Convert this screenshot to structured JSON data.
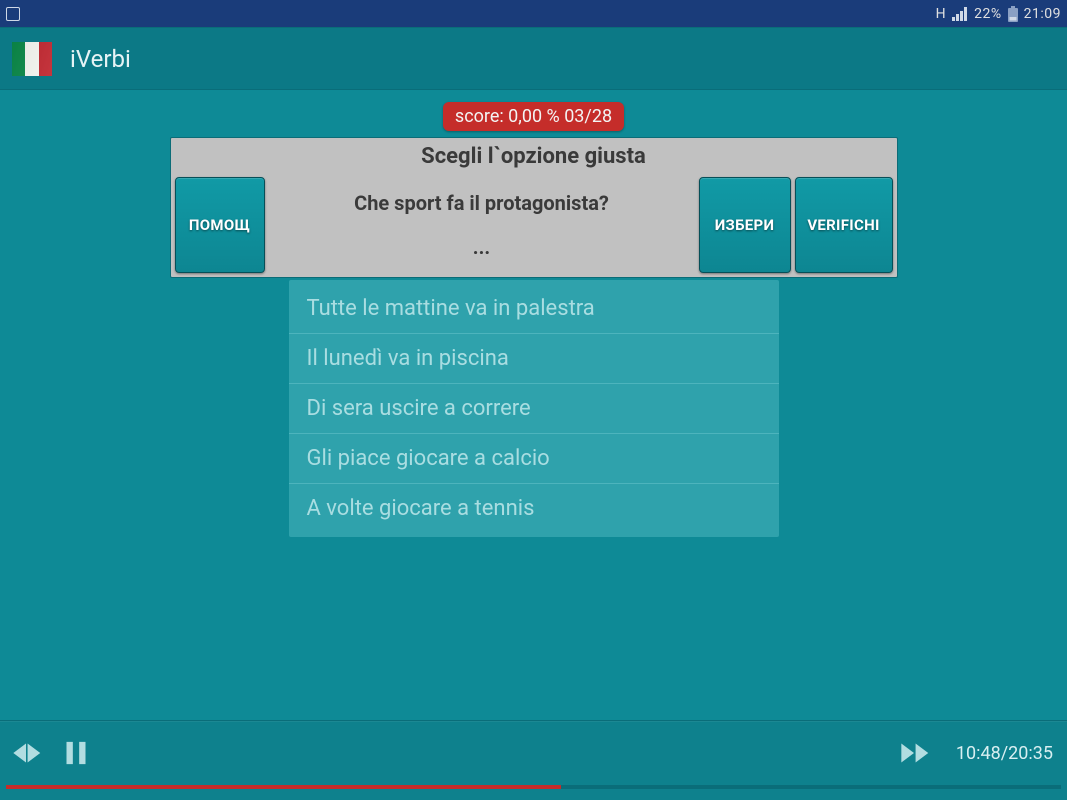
{
  "status": {
    "network_indicator": "H",
    "battery_text": "22%",
    "time": "21:09"
  },
  "app": {
    "title": "iVerbi"
  },
  "score": {
    "label": "score: 0,00 %  03/28"
  },
  "card": {
    "title": "Scegli l`opzione giusta",
    "help_label": "ПОМОЩ",
    "select_label": "ИЗБЕРИ",
    "verify_label": "VERIFICHI",
    "question": "Che sport fa il protagonista?",
    "placeholder": "..."
  },
  "options": [
    "Tutte le mattine va in palestra",
    "Il lunedì va in piscina",
    "Di sera uscire a correre",
    "Gli piace giocare a calcio",
    "A volte giocare a tennis"
  ],
  "player": {
    "elapsed": "10:48",
    "total": "20:35",
    "progress_percent": 52.6
  }
}
